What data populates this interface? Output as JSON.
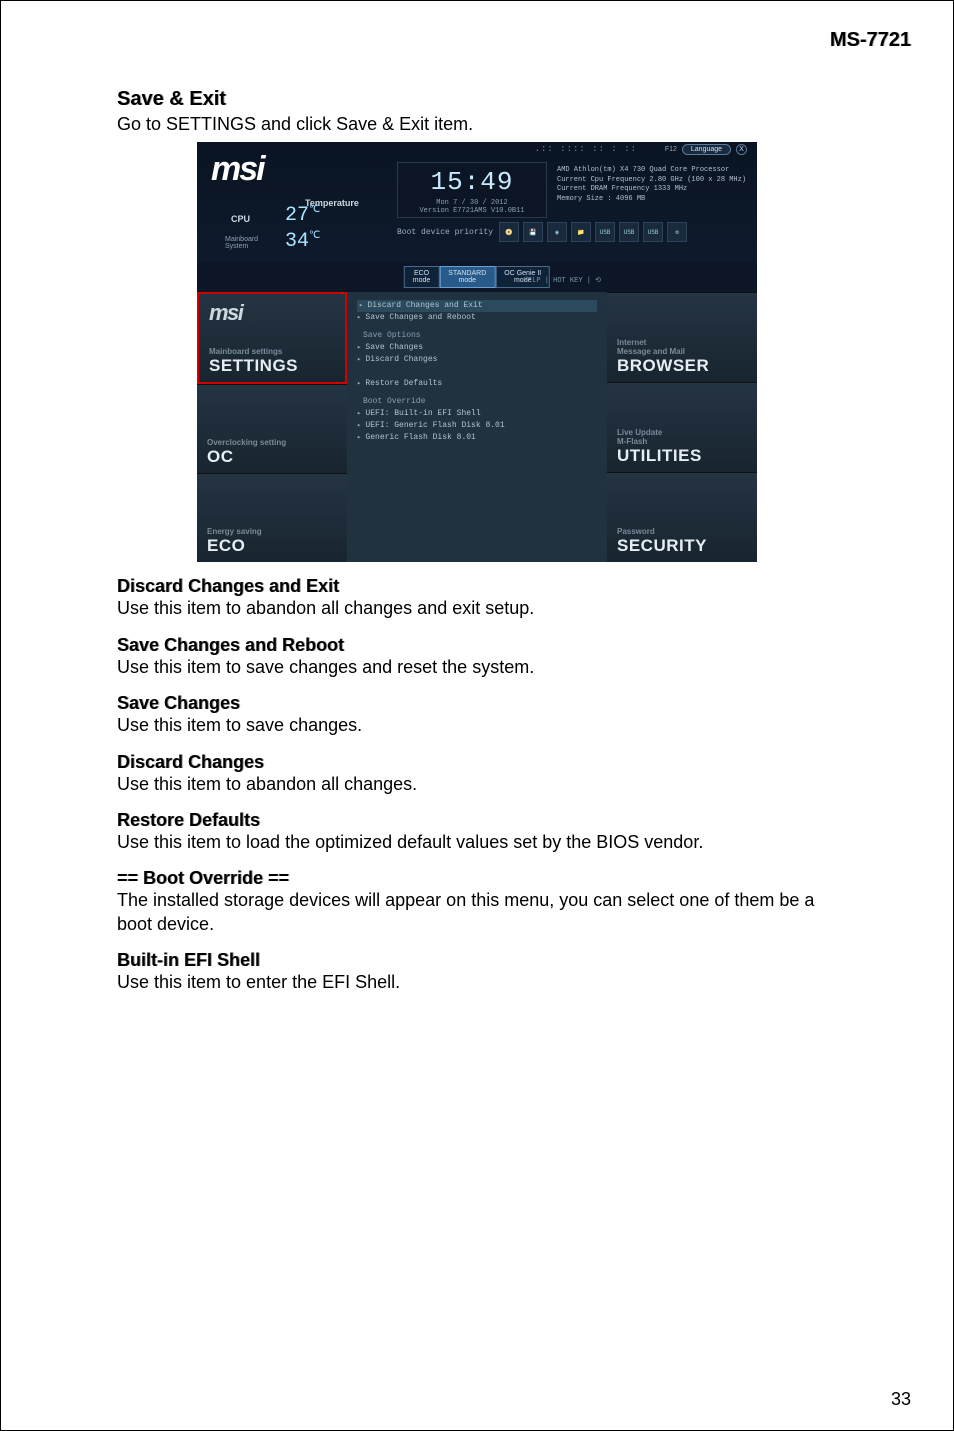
{
  "header": {
    "model": "MS-7721"
  },
  "page_number": "33",
  "intro": {
    "title": "Save & Exit",
    "desc": "Go to SETTINGS and click Save & Exit item."
  },
  "items": [
    {
      "title": "Discard Changes and Exit",
      "desc": "Use this item to abandon all changes and exit setup."
    },
    {
      "title": "Save Changes and Reboot",
      "desc": "Use this item to save changes and reset the system."
    },
    {
      "title": "Save Changes",
      "desc": "Use this item to save changes."
    },
    {
      "title": "Discard Changes",
      "desc": "Use this item to abandon all changes."
    },
    {
      "title": "Restore Defaults",
      "desc": "Use this item to load the optimized default values set by the BIOS vendor."
    },
    {
      "title": "== Boot Override ==",
      "desc": "The installed storage devices will appear on this menu, you can select one of them be a boot device."
    },
    {
      "title": "Built-in EFI Shell",
      "desc": "Use this item to enter the EFI Shell."
    }
  ],
  "bios": {
    "logo": "msi",
    "temp_label": "Temperature",
    "cpu_label": "CPU",
    "mb_label1": "Mainboard",
    "mb_label2": "System",
    "cpu_temp": "27",
    "mb_temp": "34",
    "clock": "15:49",
    "date": "Mon  7 / 30 / 2012",
    "version": "Version E7721AMS V10.0B11",
    "info": {
      "l1": "AMD Athlon(tm) X4 730 Quad Core Processor",
      "l2": "Current Cpu Frequency 2.80 GHz (100 x 28 MHz)",
      "l3": "Current DRAM Frequency 1333 MHz",
      "l4": "Memory Size : 4096 MB"
    },
    "boot_label": "Boot device priority",
    "modes": {
      "eco": "ECO\nmode",
      "std": "STANDARD\nmode",
      "ocg": "OC Genie II\nmode"
    },
    "lang": {
      "f12": "F12",
      "label": "Language",
      "x": "X"
    },
    "dots": ".:: :::: :: : ::",
    "help": "HELP  |  HOT KEY  |  ⟲",
    "left_tiles": {
      "settings": {
        "sub": "Mainboard settings",
        "name": "SETTINGS",
        "logo": "msi"
      },
      "oc": {
        "sub": "Overclocking setting",
        "name": "OC"
      },
      "eco": {
        "sub": "Energy saving",
        "name": "ECO"
      }
    },
    "right_tiles": {
      "browser": {
        "sub1": "Internet",
        "sub2": "Message and Mail",
        "name": "BROWSER"
      },
      "utilities": {
        "sub1": "Live Update",
        "sub2": "M-Flash",
        "name": "UTILITIES"
      },
      "security": {
        "sub1": "Password",
        "name": "SECURITY"
      }
    },
    "menu": {
      "discard_exit": "Discard Changes and Exit",
      "save_reboot": "Save Changes and Reboot",
      "save_options_header": "Save Options",
      "save_changes": "Save Changes",
      "discard_changes": "Discard Changes",
      "restore_defaults": "Restore Defaults",
      "boot_override_header": "Boot Override",
      "uefi_shell": "UEFI: Built-in EFI Shell",
      "uefi_generic": "UEFI: Generic Flash Disk 8.01",
      "generic": "Generic Flash Disk 8.01"
    },
    "boot_icons": [
      "📀",
      "💾",
      "◉",
      "📁",
      "USB",
      "USB",
      "USB",
      "⚙"
    ]
  }
}
